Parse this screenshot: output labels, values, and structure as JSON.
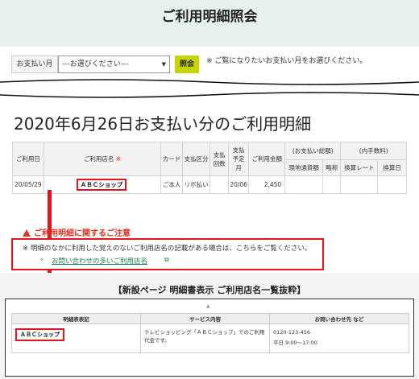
{
  "page": {
    "title": "ご利用明細照会"
  },
  "period": {
    "label": "お支払い月",
    "select_value": "---お選びください---",
    "button": "照会",
    "note": "※ ご覧になりたいお支払い月をお選びください。"
  },
  "statement": {
    "title": "2020年6月26日お支払い分のご利用明細",
    "headers": {
      "date": "ご利用日",
      "shop": "ご利用店名",
      "shop_req": "※",
      "card": "カード",
      "payment": "支払区分",
      "installments": "支払回数",
      "scheduled": "支払予定月",
      "amount": "ご利用金額",
      "foreign_group": "(お支払い総額)",
      "local_currency": "現地通貨額",
      "abbr": "略称",
      "fee_group": "(内手数料)",
      "rate": "換算レート",
      "conv_date": "換算日"
    },
    "row": {
      "date": "20/05/29",
      "shop": "ＡＢＣショップ",
      "card": "ご本人",
      "payment": "リボ払い",
      "installments": "",
      "scheduled": "20/06",
      "amount": "2,450"
    }
  },
  "caution": {
    "title": "ご利用明細に関するご注意",
    "text": "※ 明細のなかに利用した覚えのないご利用店名の記載がある場合は、こちらをご覧ください。",
    "link": "お問い合わせの多いご利用店名"
  },
  "sample": {
    "title": "【新設ページ 明細書表示  ご利用店名一覧抜粋】",
    "headers": [
      "明細表表記",
      "サービス内容",
      "お問い合わせ先 など"
    ],
    "row": {
      "name": "ＡＢＣショップ",
      "service": "テレビショッピング「ＡＢＣショップ」でのご利用代金です。",
      "phone": "0120-123-456",
      "hours": "平日  9:00〜17:00"
    }
  },
  "colors": {
    "accent_red": "#e0161c",
    "header_bg": "#e6f0ee",
    "button_bg": "#c8d400",
    "link_green": "#1a7f5a"
  }
}
